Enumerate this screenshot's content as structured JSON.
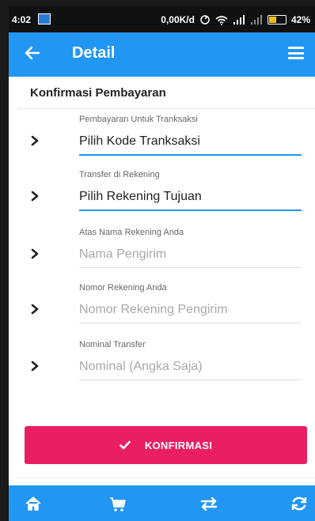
{
  "status_bar": {
    "time": "4:02",
    "network_speed": "0,00K/d",
    "battery_percent": "42%"
  },
  "app_bar": {
    "title": "Detail",
    "back_icon": "arrow-left-icon",
    "menu_icon": "hamburger-menu-icon"
  },
  "section": {
    "title": "Konfirmasi Pembayaran"
  },
  "form": {
    "fields": [
      {
        "label": "Pembayaran Untuk Tranksaksi",
        "value": "Pilih Kode Tranksaksi",
        "placeholder": "",
        "active": true
      },
      {
        "label": "Transfer di Rekening",
        "value": "Pilih Rekening Tujuan",
        "placeholder": "",
        "active": true
      },
      {
        "label": "Atas Nama Rekening Anda",
        "value": "",
        "placeholder": "Nama Pengirim",
        "active": false
      },
      {
        "label": "Nomor Rekening Anda",
        "value": "",
        "placeholder": "Nomor Rekening Pengirim",
        "active": false
      },
      {
        "label": "Nominal Transfer",
        "value": "",
        "placeholder": "Nominal (Angka Saja)",
        "active": false
      }
    ]
  },
  "confirm_button": {
    "label": "KONFIRMASI",
    "icon": "check-icon"
  },
  "bottom_nav": {
    "items": [
      "home-icon",
      "cart-icon",
      "transfer-icon",
      "refresh-icon"
    ]
  },
  "colors": {
    "primary": "#2196F3",
    "accent": "#E91E63"
  }
}
